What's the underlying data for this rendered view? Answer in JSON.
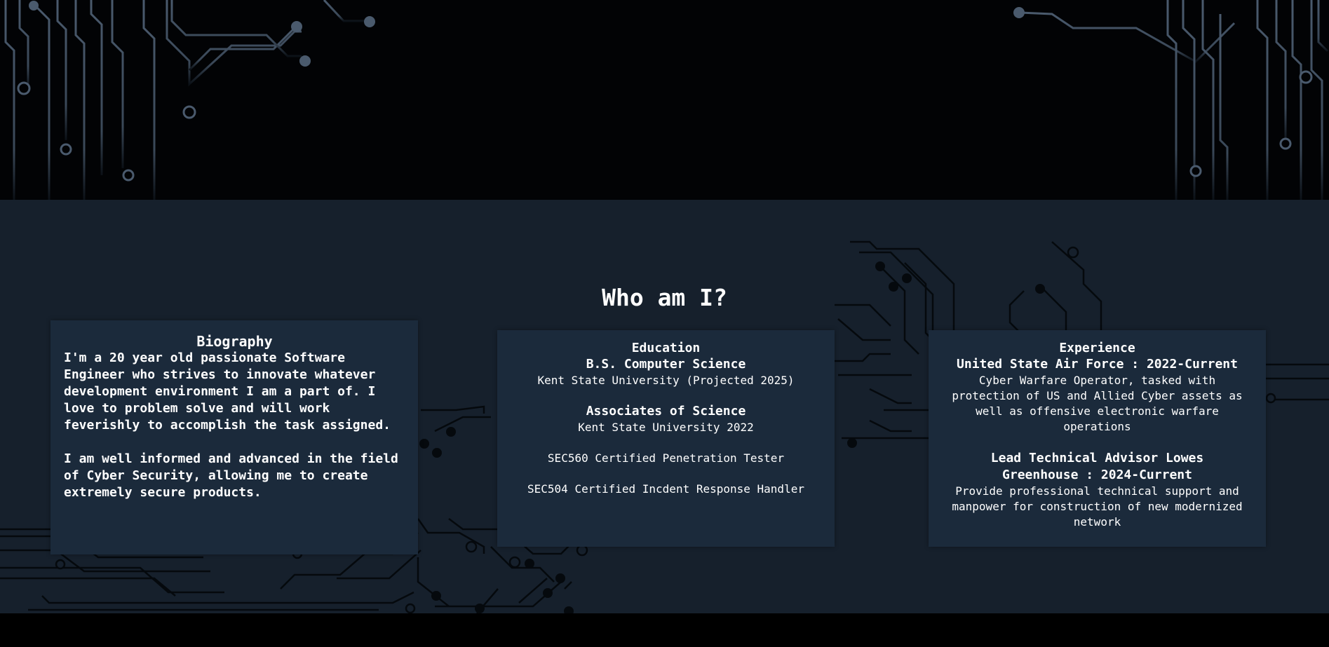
{
  "about": {
    "title": "Who am I?",
    "biography": {
      "heading": "Biography",
      "paragraphs": [
        "I'm a 20 year old passionate Software Engineer who strives to innovate whatever development environment I am a part of. I love to problem solve and will work feverishly to accomplish the task assigned.",
        "I am well informed and advanced in the field of Cyber Security, allowing me to create extremely secure products."
      ]
    },
    "education": {
      "heading": "Education",
      "degree1": "B.S. Computer Science",
      "school1": "Kent State University (Projected 2025)",
      "degree2": "Associates of Science",
      "school2": "Kent State University 2022",
      "cert1": "SEC560 Certified Penetration Tester",
      "cert2": "SEC504 Certified Incdent Response Handler"
    },
    "experience": {
      "heading": "Experience",
      "job1_title": "United State Air Force : 2022-Current",
      "job1_desc": "Cyber Warfare Operator, tasked with protection of US and Allied Cyber assets as well as offensive electronic warfare operations",
      "job2_title": "Lead Technical Advisor Lowes Greenhouse : 2024-Current",
      "job2_desc": "Provide professional technical support and manpower for construction of new modernized network"
    }
  },
  "colors": {
    "hero_bg": "#020305",
    "section_bg": "#16202c",
    "card_bg": "#1b2a3b",
    "circuit_light": "#3b4a5c",
    "circuit_dark": "#05090d",
    "text": "#ffffff"
  },
  "decor": {
    "hero_left": "circuit-board-pattern",
    "hero_right": "circuit-board-pattern",
    "section_background": "circuit-board-pattern"
  }
}
